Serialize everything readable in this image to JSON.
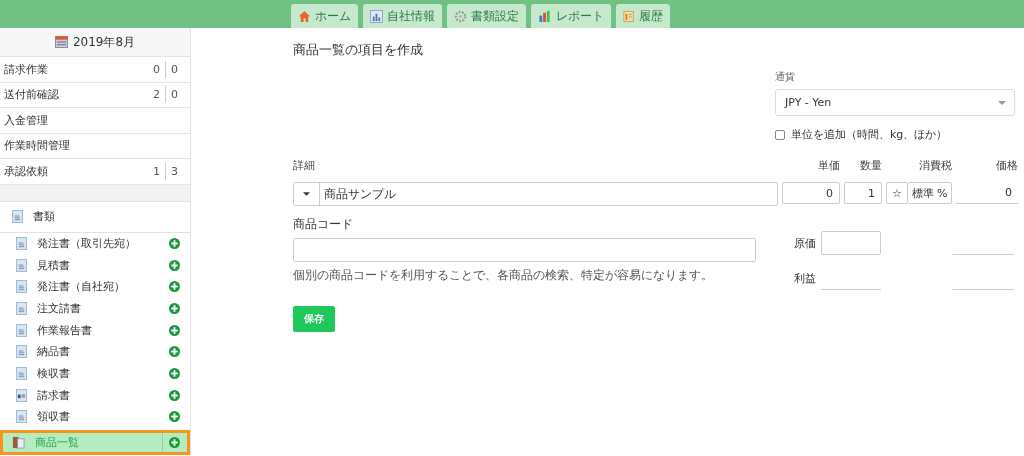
{
  "top_tabs": [
    {
      "label": "ホーム",
      "kind": "home"
    },
    {
      "label": "自社情報",
      "kind": "company"
    },
    {
      "label": "書類設定",
      "kind": "settings"
    },
    {
      "label": "レポート",
      "kind": "report"
    },
    {
      "label": "履歴",
      "kind": "history"
    }
  ],
  "sidebar": {
    "month": "2019年8月",
    "tasks": [
      {
        "label": "請求作業",
        "counts": [
          "0",
          "0"
        ]
      },
      {
        "label": "送付前確認",
        "counts": [
          "2",
          "0"
        ]
      },
      {
        "label": "入金管理"
      },
      {
        "label": "作業時間管理"
      },
      {
        "label": "承認依頼",
        "counts": [
          "1",
          "3"
        ]
      }
    ],
    "section": "書類",
    "documents": [
      {
        "label": "発注書（取引先宛）",
        "kind": "document",
        "selected": false
      },
      {
        "label": "見積書",
        "kind": "document",
        "selected": false
      },
      {
        "label": "発注書（自社宛）",
        "kind": "document",
        "selected": false
      },
      {
        "label": "注文請書",
        "kind": "document",
        "selected": false
      },
      {
        "label": "作業報告書",
        "kind": "document",
        "selected": false
      },
      {
        "label": "納品書",
        "kind": "document",
        "selected": false
      },
      {
        "label": "検収書",
        "kind": "document",
        "selected": false
      },
      {
        "label": "請求書",
        "kind": "invoice",
        "selected": false
      },
      {
        "label": "領収書",
        "kind": "document",
        "selected": false
      },
      {
        "label": "商品一覧",
        "kind": "catalog",
        "selected": true
      }
    ]
  },
  "form": {
    "title": "商品一覧の項目を作成",
    "currency": {
      "label": "通貨",
      "value": "JPY - Yen"
    },
    "unit_option": {
      "label": "単位を追加（時間、kg、ほか）",
      "checked": false
    },
    "columns": [
      "詳細",
      "単価",
      "数量",
      "消費税",
      "価格"
    ],
    "line": {
      "description": "商品サンプル",
      "unit_price": "0",
      "quantity": "1",
      "tax_mark": "☆",
      "tax_rate": "標準 %",
      "price": "0"
    },
    "product_code": {
      "label": "商品コード",
      "help": "個別の商品コードを利用することで、各商品の検索、特定が容易になります。"
    },
    "cost_label": "原価",
    "profit_label": "利益",
    "save": "保存"
  }
}
